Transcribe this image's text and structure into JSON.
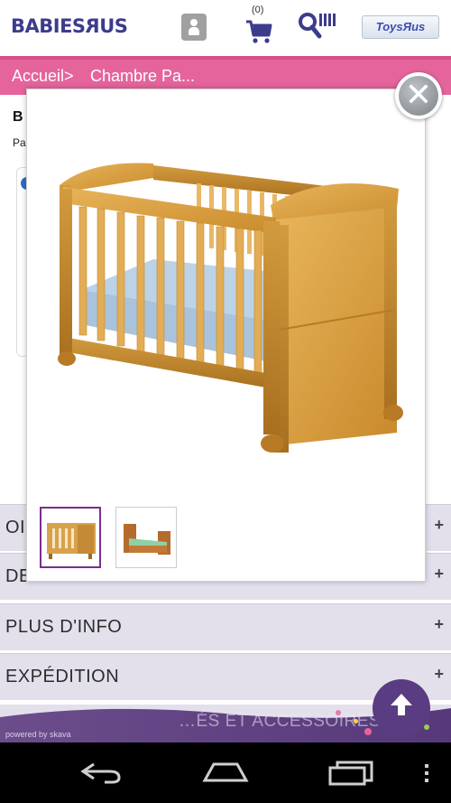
{
  "header": {
    "logo_babies": "BABIES",
    "logo_r": "R",
    "logo_us": "US",
    "cart_count": "(0)",
    "toysrus_label": "ToysЯus"
  },
  "breadcrumb": {
    "home": "Accueil>",
    "current": "Chambre Pa..."
  },
  "background_page": {
    "title_fragment": "B",
    "subtitle_fragment": "Pa"
  },
  "modal": {
    "close_symbol": "✕"
  },
  "accordion": [
    {
      "label": "OI",
      "plus": "+"
    },
    {
      "label": "DESCRIPTION",
      "plus": "+"
    },
    {
      "label": "PLUS D'INFO",
      "plus": "+"
    },
    {
      "label": "EXPÉDITION",
      "plus": "+"
    }
  ],
  "footer": {
    "powered_by": "powered by skava",
    "accessoires": "…ÉS ET ACCESSOIRES"
  },
  "colors": {
    "brand_pink": "#e5649c",
    "brand_purple": "#5a3c82",
    "accordion_bg": "#e3e0ec"
  },
  "icons": [
    "account-icon",
    "cart-icon",
    "search-icon",
    "close-icon",
    "scroll-top-icon",
    "back-icon",
    "home-icon",
    "recents-icon",
    "menu-icon"
  ]
}
